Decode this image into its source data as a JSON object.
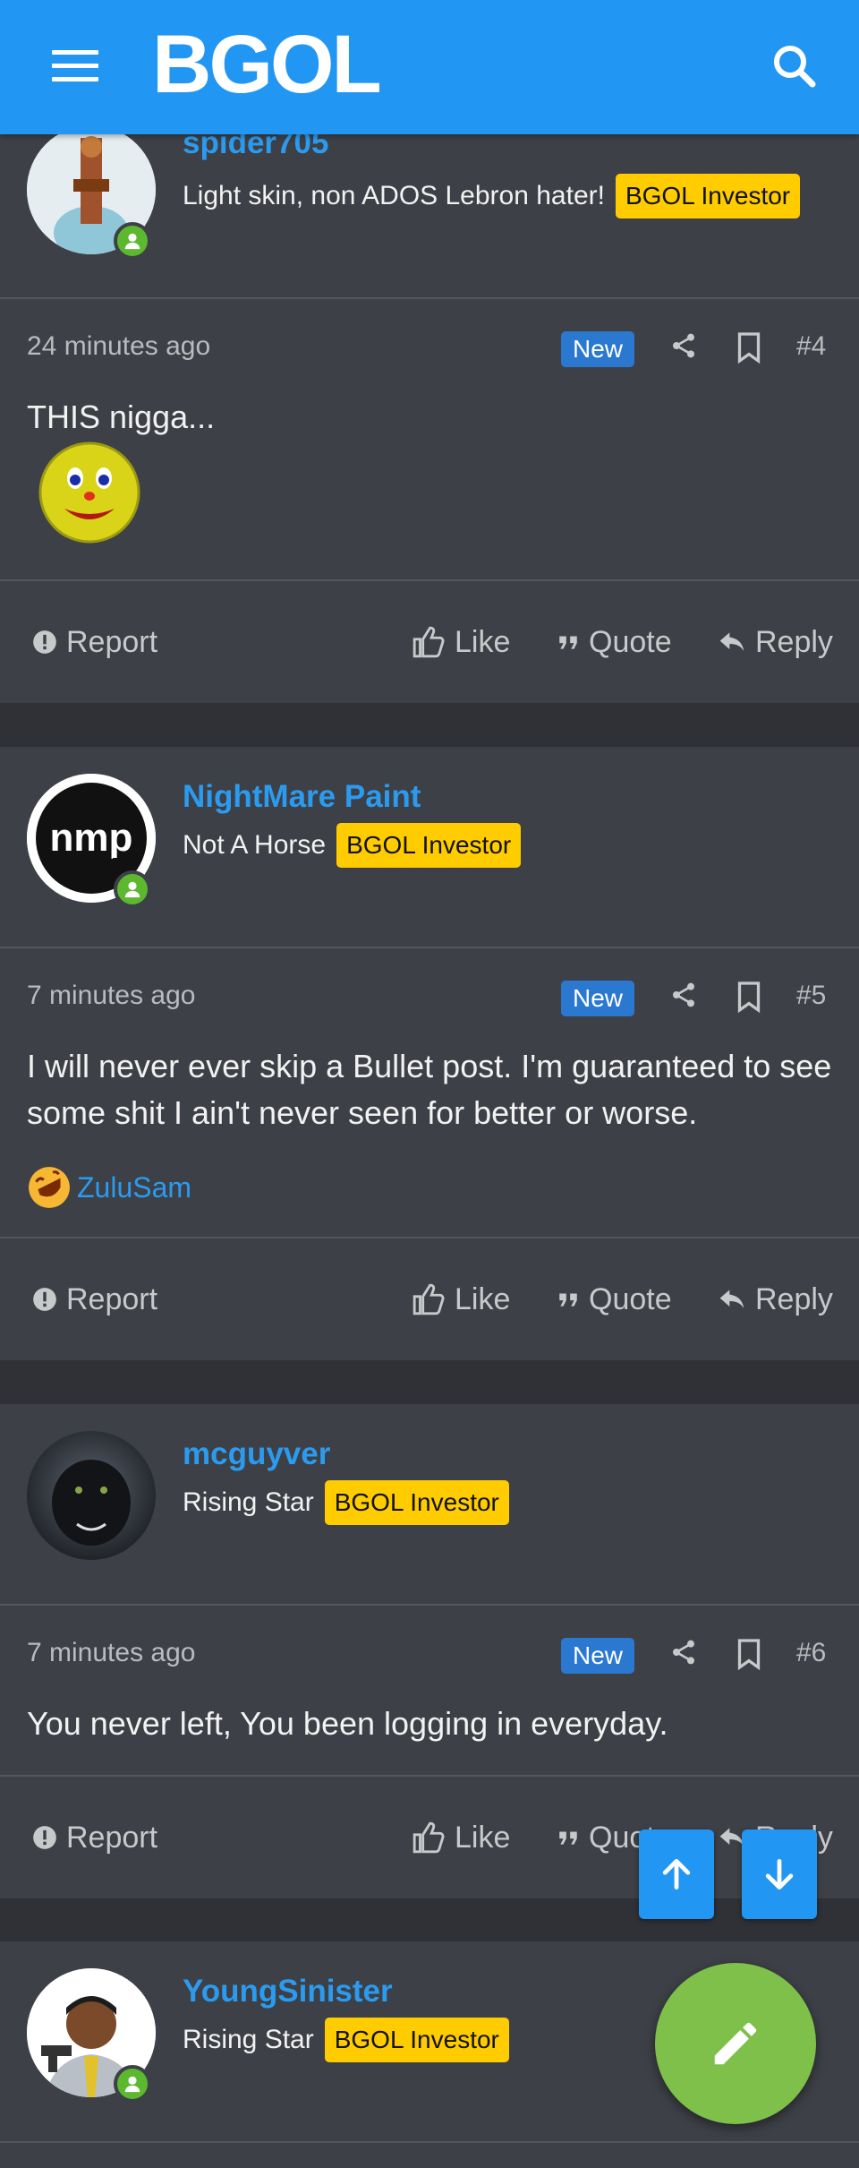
{
  "header": {
    "logo": "BGOL"
  },
  "posts": [
    {
      "username": "spider705",
      "user_title": "Light skin, non ADOS Lebron hater!",
      "badge": "BGOL Investor",
      "time": "24 minutes ago",
      "new_label": "New",
      "number": "#4",
      "message": "THIS nigga..."
    },
    {
      "username": "NightMare Paint",
      "user_title": "Not A Horse",
      "badge": "BGOL Investor",
      "time": "7 minutes ago",
      "new_label": "New",
      "number": "#5",
      "message": "I will never ever skip a Bullet post. I'm guaranteed to see some shit I ain't never seen for better or worse.",
      "reaction_user": "ZuluSam"
    },
    {
      "username": "mcguyver",
      "user_title": "Rising Star",
      "badge": "BGOL Investor",
      "time": "7 minutes ago",
      "new_label": "New",
      "number": "#6",
      "message": "You never left, You been logging in everyday."
    },
    {
      "username": "YoungSinister",
      "user_title": "Rising Star",
      "badge": "BGOL Investor"
    }
  ],
  "actions": {
    "report": "Report",
    "like": "Like",
    "quote": "Quote",
    "reply": "Reply"
  },
  "colors": {
    "header": "#2196f3",
    "username": "#2b9bf0",
    "badge": "#ffcc00",
    "new_badge": "#2b78d1",
    "online": "#5cb82f",
    "fab_write": "#7ec04a"
  }
}
